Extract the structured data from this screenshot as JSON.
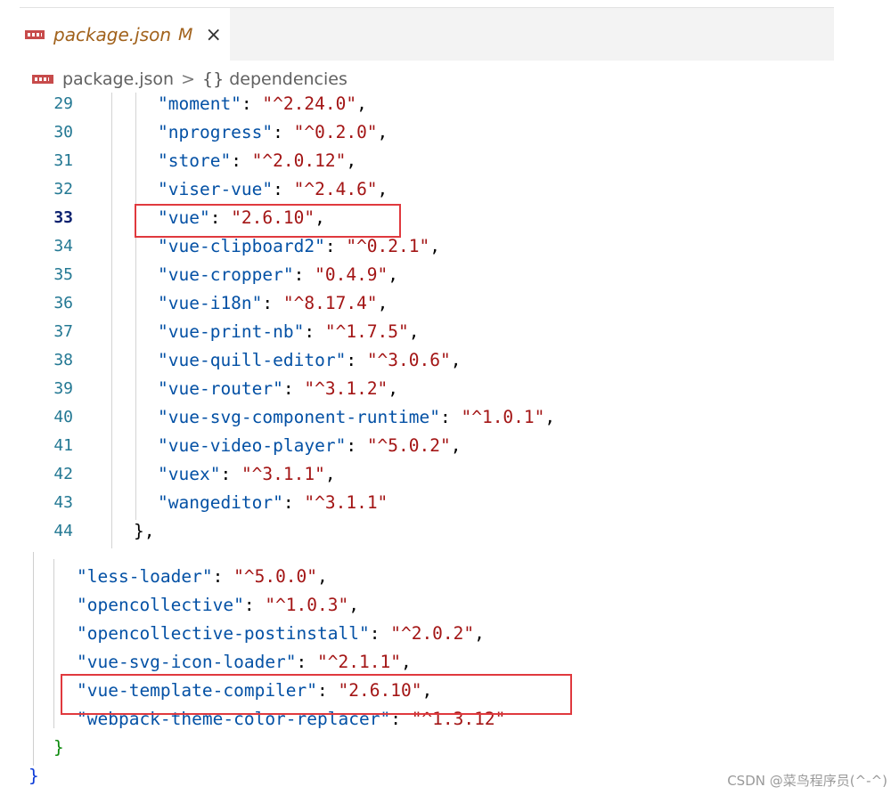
{
  "tab": {
    "title": "package.json",
    "modified": "M",
    "close": "×"
  },
  "breadcrumb": {
    "file": "package.json",
    "separator": ">",
    "braces": "{}",
    "section": "dependencies"
  },
  "editor1": {
    "lines": [
      {
        "n": "29",
        "key": "\"moment\"",
        "value": "\"^2.24.0\"",
        "end": ","
      },
      {
        "n": "30",
        "key": "\"nprogress\"",
        "value": "\"^0.2.0\"",
        "end": ","
      },
      {
        "n": "31",
        "key": "\"store\"",
        "value": "\"^2.0.12\"",
        "end": ","
      },
      {
        "n": "32",
        "key": "\"viser-vue\"",
        "value": "\"^2.4.6\"",
        "end": ","
      },
      {
        "n": "33",
        "key": "\"vue\"",
        "value": "\"2.6.10\"",
        "end": ","
      },
      {
        "n": "34",
        "key": "\"vue-clipboard2\"",
        "value": "\"^0.2.1\"",
        "end": ","
      },
      {
        "n": "35",
        "key": "\"vue-cropper\"",
        "value": "\"0.4.9\"",
        "end": ","
      },
      {
        "n": "36",
        "key": "\"vue-i18n\"",
        "value": "\"^8.17.4\"",
        "end": ","
      },
      {
        "n": "37",
        "key": "\"vue-print-nb\"",
        "value": "\"^1.7.5\"",
        "end": ","
      },
      {
        "n": "38",
        "key": "\"vue-quill-editor\"",
        "value": "\"^3.0.6\"",
        "end": ","
      },
      {
        "n": "39",
        "key": "\"vue-router\"",
        "value": "\"^3.1.2\"",
        "end": ","
      },
      {
        "n": "40",
        "key": "\"vue-svg-component-runtime\"",
        "value": "\"^1.0.1\"",
        "end": ","
      },
      {
        "n": "41",
        "key": "\"vue-video-player\"",
        "value": "\"^5.0.2\"",
        "end": ","
      },
      {
        "n": "42",
        "key": "\"vuex\"",
        "value": "\"^3.1.1\"",
        "end": ","
      },
      {
        "n": "43",
        "key": "\"wangeditor\"",
        "value": "\"^3.1.1\"",
        "end": ""
      }
    ],
    "closing": {
      "n": "44",
      "text": "},"
    },
    "active_line": "33"
  },
  "editor2": {
    "lines": [
      {
        "key": "\"less-loader\"",
        "value": "\"^5.0.0\"",
        "end": ","
      },
      {
        "key": "\"opencollective\"",
        "value": "\"^1.0.3\"",
        "end": ","
      },
      {
        "key": "\"opencollective-postinstall\"",
        "value": "\"^2.0.2\"",
        "end": ","
      },
      {
        "key": "\"vue-svg-icon-loader\"",
        "value": "\"^2.1.1\"",
        "end": ","
      },
      {
        "key": "\"vue-template-compiler\"",
        "value": "\"2.6.10\"",
        "end": ","
      },
      {
        "key": "\"webpack-theme-color-replacer\"",
        "value": "\"^1.3.12\"",
        "end": ""
      }
    ],
    "inner_close": "}",
    "outer_close": "}"
  },
  "watermark": "CSDN @菜鸟程序员(^-^)",
  "colors": {
    "key": "#0451a5",
    "string": "#a31515",
    "highlight_box": "#e0393e",
    "line_number": "#237893"
  }
}
